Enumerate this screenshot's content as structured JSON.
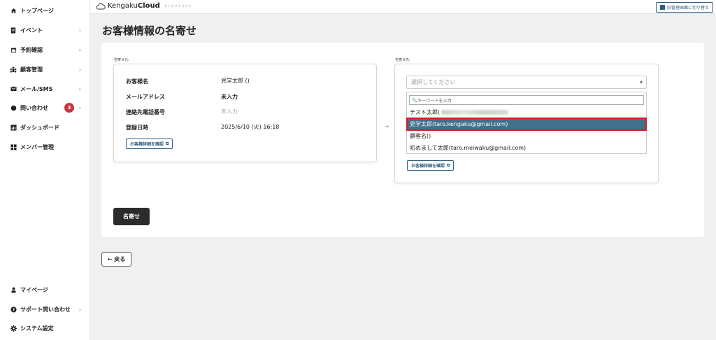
{
  "sidebar": {
    "items": [
      {
        "label": "トップページ",
        "icon": "home-icon"
      },
      {
        "label": "イベント",
        "icon": "document-icon",
        "chevron": "›"
      },
      {
        "label": "予約確認",
        "icon": "calendar-icon",
        "chevron": "›"
      },
      {
        "label": "顧客管理",
        "icon": "users-icon",
        "chevron": "›"
      },
      {
        "label": "メール/SMS",
        "icon": "mail-icon",
        "chevron": "›"
      },
      {
        "label": "問い合わせ",
        "icon": "chat-icon",
        "chevron": "›",
        "badge": "3"
      },
      {
        "label": "ダッシュボード",
        "icon": "chart-icon"
      },
      {
        "label": "メンバー管理",
        "icon": "grid-icon"
      }
    ],
    "bottom_items": [
      {
        "label": "マイページ",
        "icon": "person-icon"
      },
      {
        "label": "サポート問い合わせ",
        "icon": "question-icon",
        "chevron": "›"
      },
      {
        "label": "システム設定",
        "icon": "gear-icon"
      }
    ]
  },
  "topbar": {
    "logo_light": "Kengaku",
    "logo_bold": "Cloud",
    "logo_sub": "ケンガククラウド",
    "switch_label": "旧管理画面に切り替え"
  },
  "page": {
    "title": "お客様情報の名寄せ",
    "left_label": "名寄せ元:",
    "right_label": "名寄せ先:",
    "arrow": "→"
  },
  "source": {
    "rows": [
      {
        "label": "お客様名",
        "value": "見学太郎 ()"
      },
      {
        "label": "メールアドレス",
        "value": "未入力"
      },
      {
        "label": "連絡先電話番号",
        "value": "未入力"
      },
      {
        "label": "登録日時",
        "value": "2025/6/10 (火) 16:18"
      }
    ],
    "detail_button": "お客様詳細を確認"
  },
  "target": {
    "select_placeholder": "選択してください",
    "search_placeholder": "キーワードを入力",
    "options": [
      {
        "label": "テスト太郎("
      },
      {
        "label": "見学太郎(taro.kengaku@gmail.com)"
      },
      {
        "label": "顧客名()"
      },
      {
        "label": "初めまして太郎(taro.meiwaku@gmail.com)"
      }
    ],
    "detail_button": "お客様詳細を確認"
  },
  "actions": {
    "merge": "名寄せ",
    "back": "← 戻る"
  },
  "colors": {
    "accent": "#2f5f7f",
    "selected_bg": "#41708c",
    "highlight_border": "#d21e28",
    "badge": "#c9353b"
  }
}
